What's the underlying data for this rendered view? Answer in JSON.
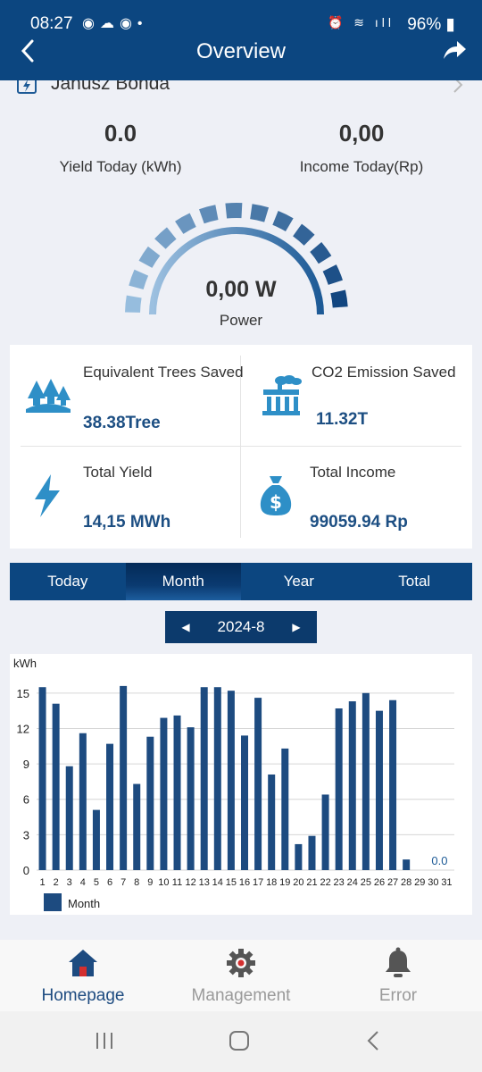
{
  "status_bar": {
    "time": "08:27",
    "battery": "96%"
  },
  "header": {
    "title": "Overview"
  },
  "plant": {
    "name": "Janusz Bonda"
  },
  "kpis": {
    "yield_today": {
      "value": "0.0",
      "label": "Yield Today (kWh)"
    },
    "income_today": {
      "value": "0,00",
      "label": "Income Today(Rp)"
    }
  },
  "power": {
    "value": "0,00 W",
    "label": "Power",
    "level": 0
  },
  "stats": {
    "trees": {
      "label": "Equivalent Trees Saved",
      "value": "38.38Tree"
    },
    "co2": {
      "label": "CO2 Emission Saved",
      "value": "11.32T"
    },
    "total_yield": {
      "label": "Total Yield",
      "value": "14,15 MWh"
    },
    "total_income": {
      "label": "Total Income",
      "value": "99059.94 Rp"
    }
  },
  "tabs": [
    "Today",
    "Month",
    "Year",
    "Total"
  ],
  "active_tab": "Month",
  "date_selector": {
    "value": "2024-8"
  },
  "colors": {
    "primary": "#0c4680",
    "bar": "#1d4b80",
    "accent_value": "#1d4f83",
    "home_active": "#1d4b80",
    "nav_inactive": "#9a9a9a"
  },
  "chart_data": {
    "type": "bar",
    "ylabel": "kWh",
    "ylim": [
      0,
      16.5
    ],
    "yticks": [
      0,
      3,
      6,
      9,
      12,
      15
    ],
    "categories": [
      "1",
      "2",
      "3",
      "4",
      "5",
      "6",
      "7",
      "8",
      "9",
      "10",
      "11",
      "12",
      "13",
      "14",
      "15",
      "16",
      "17",
      "18",
      "19",
      "20",
      "21",
      "22",
      "23",
      "24",
      "25",
      "26",
      "27",
      "28",
      "29",
      "30",
      "31"
    ],
    "series": [
      {
        "name": "Month",
        "values": [
          15.5,
          14.1,
          8.8,
          11.6,
          5.1,
          10.7,
          15.6,
          7.3,
          11.3,
          12.9,
          13.1,
          12.1,
          15.5,
          15.5,
          15.2,
          11.4,
          14.6,
          8.1,
          10.3,
          2.2,
          2.9,
          6.4,
          13.7,
          14.3,
          15.0,
          13.5,
          14.4,
          0.9,
          0,
          0,
          0
        ]
      }
    ],
    "annotation": "0.0",
    "grid": true,
    "legend": "bottom-left"
  },
  "bottom_nav": [
    {
      "label": "Homepage",
      "icon": "home-icon",
      "active": true
    },
    {
      "label": "Management",
      "icon": "gear-icon",
      "active": false
    },
    {
      "label": "Error",
      "icon": "bell-icon",
      "active": false
    }
  ]
}
